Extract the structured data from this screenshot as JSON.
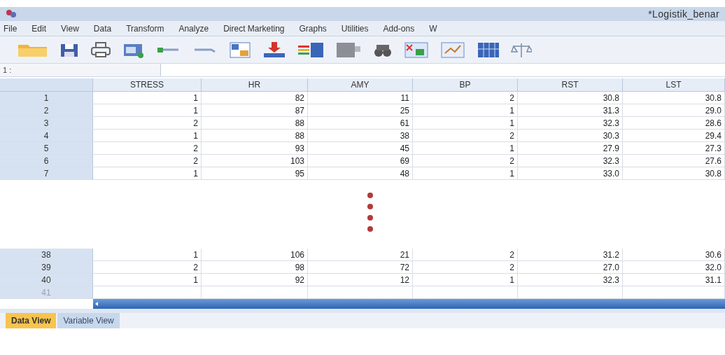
{
  "window": {
    "title": "*Logistik_benar"
  },
  "menu": [
    "File",
    "Edit",
    "View",
    "Data",
    "Transform",
    "Analyze",
    "Direct Marketing",
    "Graphs",
    "Utilities",
    "Add-ons",
    "W"
  ],
  "cell_editor": {
    "reference": "1 :"
  },
  "table": {
    "columns": [
      "STRESS",
      "HR",
      "AMY",
      "BP",
      "RST",
      "LST"
    ],
    "upper_rows": [
      {
        "kind": "case",
        "header": "1",
        "cells": [
          "1",
          "82",
          "11",
          "2",
          "30.8",
          "30.8"
        ]
      },
      {
        "kind": "case",
        "header": "2",
        "cells": [
          "1",
          "87",
          "25",
          "1",
          "31.3",
          "29.0"
        ]
      },
      {
        "kind": "case",
        "header": "3",
        "cells": [
          "2",
          "88",
          "61",
          "1",
          "32.3",
          "28.6"
        ]
      },
      {
        "kind": "case",
        "header": "4",
        "cells": [
          "1",
          "88",
          "38",
          "2",
          "30.3",
          "29.4"
        ]
      },
      {
        "kind": "case",
        "header": "5",
        "cells": [
          "2",
          "93",
          "45",
          "1",
          "27.9",
          "27.3"
        ]
      },
      {
        "kind": "case",
        "header": "6",
        "cells": [
          "2",
          "103",
          "69",
          "2",
          "32.3",
          "27.6"
        ]
      },
      {
        "kind": "case",
        "header": "7",
        "cells": [
          "1",
          "95",
          "48",
          "1",
          "33.0",
          "30.8"
        ]
      }
    ],
    "lower_rows": [
      {
        "kind": "case",
        "header": "38",
        "cells": [
          "1",
          "106",
          "21",
          "2",
          "31.2",
          "30.6"
        ]
      },
      {
        "kind": "case",
        "header": "39",
        "cells": [
          "2",
          "98",
          "72",
          "2",
          "27.0",
          "32.0"
        ]
      },
      {
        "kind": "case",
        "header": "40",
        "cells": [
          "1",
          "92",
          "12",
          "1",
          "32.3",
          "31.1"
        ]
      },
      {
        "kind": "new",
        "header": "41"
      }
    ]
  },
  "tabs": [
    {
      "label": "Data View",
      "selected": true
    },
    {
      "label": "Variable View",
      "selected": false
    }
  ]
}
